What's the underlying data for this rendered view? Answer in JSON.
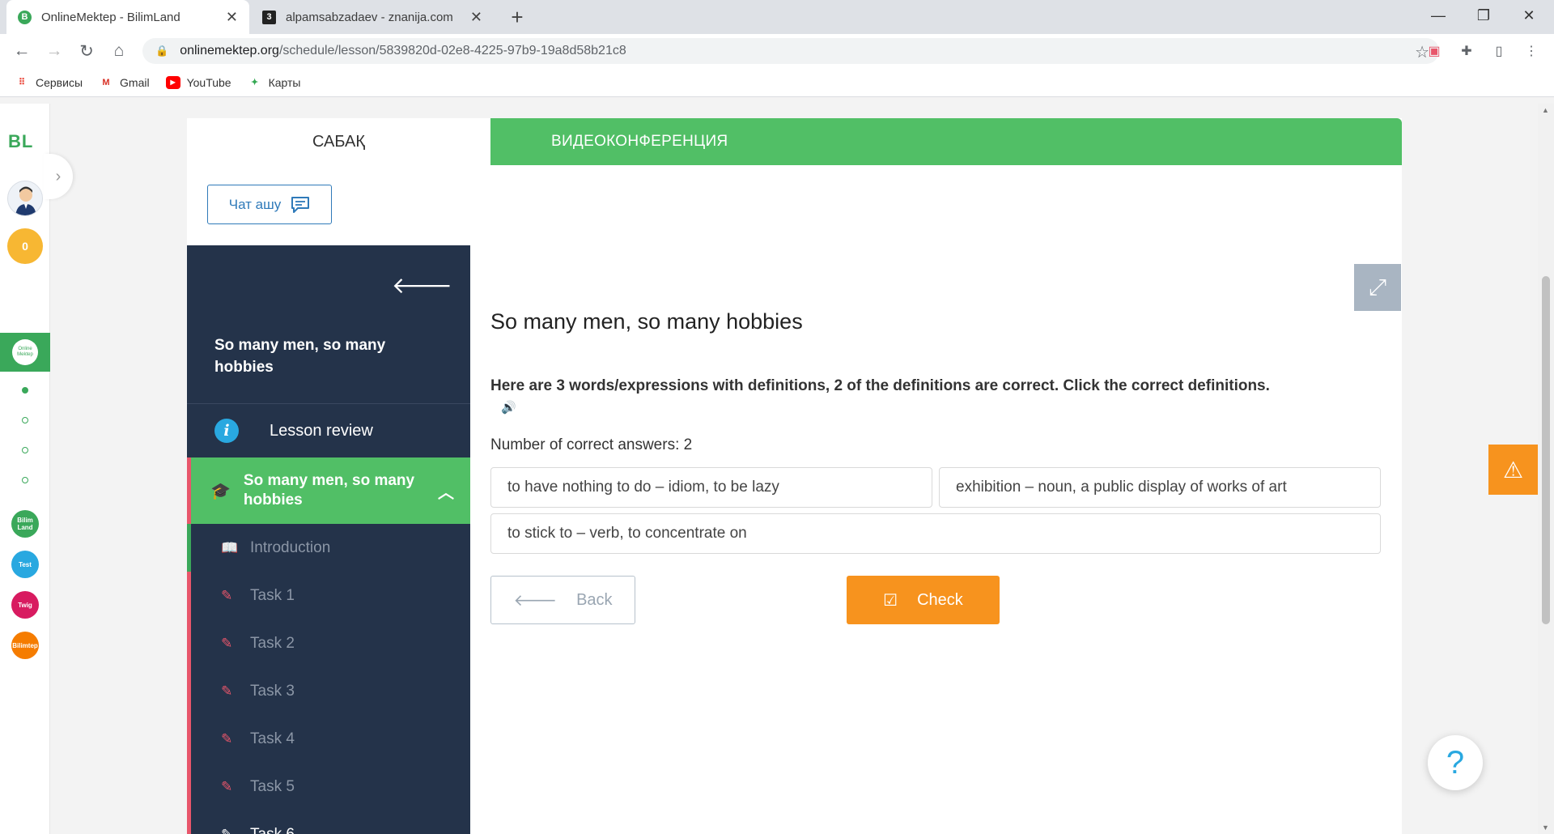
{
  "browser": {
    "tabs": [
      {
        "title": "OnlineMektep - BilimLand",
        "favicon": "B",
        "active": true
      },
      {
        "title": "alpamsabzadaev - znanija.com",
        "favicon": "3",
        "active": false
      }
    ],
    "new_tab": "+",
    "url_host": "onlinemektep.org",
    "url_path": "/schedule/lesson/5839820d-02e8-4225-97b9-19a8d58b21c8",
    "bookmarks": [
      "Сервисы",
      "Gmail",
      "YouTube",
      "Карты"
    ]
  },
  "rail": {
    "logo": "BL",
    "coins": "0",
    "active_app": "Online Mektep",
    "apps": [
      "Bilim Land",
      "Test",
      "Twig",
      "Bilimtep"
    ]
  },
  "card": {
    "tab_lesson": "САБАҚ",
    "tab_video": "ВИДЕОКОНФЕРЕНЦИЯ",
    "chat_button": "Чат ашу"
  },
  "sidebar": {
    "title": "So many men, so many hobbies",
    "review": "Lesson review",
    "section_title": "So many men, so many hobbies",
    "items": [
      "Introduction",
      "Task 1",
      "Task 2",
      "Task 3",
      "Task 4",
      "Task 5",
      "Task 6"
    ]
  },
  "main": {
    "title": "So many men, so many hobbies",
    "instruction": "Here are 3 words/expressions with definitions, 2 of the definitions are correct. Click the correct definitions.",
    "count_label": "Number of correct answers: 2",
    "answers": [
      "to have nothing to do – idiom, to be lazy",
      "exhibition – noun, a public display of works of art",
      "to stick to – verb, to concentrate on"
    ],
    "back_button": "Back",
    "check_button": "Check",
    "help": "?"
  }
}
